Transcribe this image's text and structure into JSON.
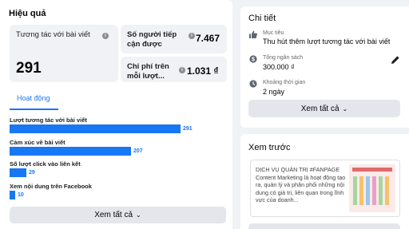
{
  "overview": {
    "title": "Hiệu quả",
    "engagement_label": "Tương tác với bài viết",
    "engagement_value": "291",
    "reach_label": "Số người tiếp cận được",
    "reach_value": "7.467",
    "cost_label": "Chi phí trên mỗi lượt...",
    "cost_value": "1.031 ₫",
    "info_glyph": "i"
  },
  "tabs": {
    "active": "Hoạt động"
  },
  "metrics": [
    {
      "label": "Lượt tương tác với bài viết",
      "value": "291",
      "ratio": 1.0
    },
    {
      "label": "Cảm xúc về bài viết",
      "value": "207",
      "ratio": 0.71
    },
    {
      "label": "Số lượt click vào liên kết",
      "value": "29",
      "ratio": 0.1
    },
    {
      "label": "Xem nội dung trên Facebook",
      "value": "10",
      "ratio": 0.035
    }
  ],
  "see_all_left": "Xem tất cả",
  "details": {
    "title": "Chi tiết",
    "goal_caption": "Mục tiêu",
    "goal_value": "Thu hút thêm lượt tương tác với bài viết",
    "budget_caption": "Tổng ngân sách",
    "budget_value": "300.000 ₫",
    "duration_caption": "Khoảng thời gian",
    "duration_value": "2 ngày",
    "see_all": "Xem tất cả"
  },
  "preview": {
    "title": "Xem trước",
    "text": "DỊCH VỤ QUẢN TRỊ #FANPAGE Content Marketing là hoạt động tạo ra, quản lý và phân phối những nội dung có giá trị, liên quan trong lĩnh vực của doanh..."
  },
  "colors": {
    "accent": "#1877f2",
    "page_bg": "#f0f2f5",
    "button_bg": "#e4e6eb"
  },
  "icons": {
    "goal": "thumbs-up-icon",
    "budget": "money-icon",
    "duration": "clock-icon",
    "edit": "pencil-icon",
    "chevron": "chevron-down-icon"
  }
}
